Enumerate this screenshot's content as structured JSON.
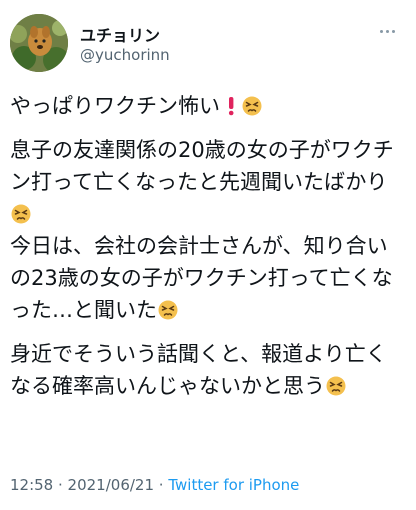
{
  "user": {
    "display_name": "ユチョリン",
    "handle": "@yuchorinn"
  },
  "tweet": {
    "line1": "やっぱりワクチン怖い",
    "para2a": "息子の友達関係の20歳の女の子がワクチン打って亡くなったと先週聞いたばかり",
    "para2b": "今日は、会社の会計士さんが、知り合いの23歳の女の子がワクチン打って亡くなった…と聞いた",
    "para3": "身近でそういう話聞くと、報道より亡くなる確率高いんじゃないかと思う"
  },
  "meta": {
    "time": "12:58",
    "separator1": " · ",
    "date": "2021/06/21",
    "separator2": " · ",
    "source": "Twitter for iPhone"
  },
  "icons": {
    "exclamation": "red-exclamation-icon",
    "face": "persevering-face-icon",
    "more": "more-options-icon"
  },
  "colors": {
    "text": "#0f1419",
    "secondary": "#536471",
    "link": "#1d9bf0",
    "exclamation": "#e0245e",
    "emoji_face": "#f4c04e"
  }
}
